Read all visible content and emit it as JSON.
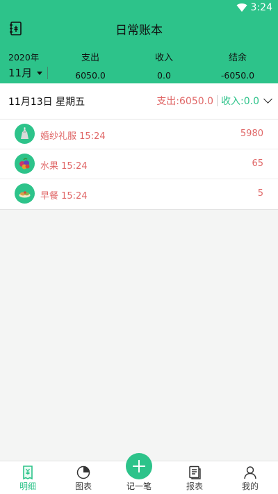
{
  "status_bar": {
    "time": "3:24"
  },
  "header": {
    "title": "日常账本"
  },
  "summary": {
    "year": "2020年",
    "month": "11月",
    "expense_label": "支出",
    "expense_value": "6050.0",
    "income_label": "收入",
    "income_value": "0.0",
    "balance_label": "结余",
    "balance_value": "-6050.0"
  },
  "day": {
    "date": "11月13日 星期五",
    "expense": "支出:6050.0",
    "income": "收入:0.0"
  },
  "records": [
    {
      "icon": "wedding-dress-icon",
      "label": "婚纱礼服 15:24",
      "amount": "5980"
    },
    {
      "icon": "fruit-icon",
      "label": "水果 15:24",
      "amount": "65"
    },
    {
      "icon": "breakfast-icon",
      "label": "早餐 15:24",
      "amount": "5"
    }
  ],
  "tabs": [
    {
      "name": "detail",
      "label": "明细",
      "active": true
    },
    {
      "name": "chart",
      "label": "图表",
      "active": false
    },
    {
      "name": "add",
      "label": "记一笔",
      "active": false
    },
    {
      "name": "report",
      "label": "报表",
      "active": false
    },
    {
      "name": "mine",
      "label": "我的",
      "active": false
    }
  ],
  "colors": {
    "accent": "#2dc38a",
    "expense": "#e06767"
  }
}
